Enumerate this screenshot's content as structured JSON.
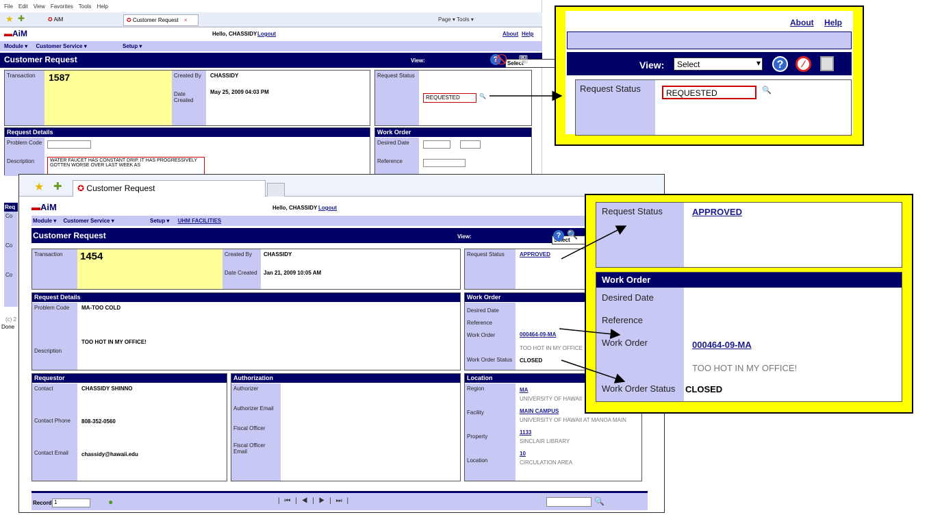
{
  "colors": {
    "navy": "#000066",
    "lavender": "#c8c8f5",
    "yellow": "#ffff00",
    "txn_yellow": "#ffff99",
    "red": "#cc0000"
  },
  "back": {
    "ie_menu": [
      "File",
      "Edit",
      "View",
      "Favorites",
      "Tools",
      "Help"
    ],
    "tabs": [
      "AiM",
      "Customer Request"
    ],
    "ie_tools": "Page ▾   Tools ▾",
    "logo": "AiM",
    "hello": "Hello, CHASSIDY",
    "logout": "Logout",
    "about": "About",
    "help": "Help",
    "menu": [
      "Module ▾",
      "Customer Service ▾",
      "Setup ▾"
    ],
    "title": "Customer Request",
    "view_label": "View:",
    "view_value": "Select",
    "transaction_label": "Transaction",
    "transaction": "1587",
    "created_by_label": "Created By",
    "created_by": "CHASSIDY",
    "date_created_label": "Date Created",
    "date_created": "May 25, 2009 04:03 PM",
    "request_status_label": "Request Status",
    "request_status": "REQUESTED",
    "request_details": "Request Details",
    "problem_code_label": "Problem Code",
    "description_label": "Description",
    "description": "WATER FAUCET HAS CONSTANT DRIP.  IT HAS PROGRESSIVELY GOTTEN WORSE OVER LAST WEEK AS",
    "work_order": "Work Order",
    "desired_date_label": "Desired Date",
    "reference_label": "Reference",
    "edge": [
      "Req",
      "Co",
      "Co",
      "Co",
      "(c) 2",
      "Done"
    ]
  },
  "zoom1": {
    "about": "About",
    "help": "Help",
    "view_label": "View:",
    "view_value": "Select",
    "request_status_label": "Request Status",
    "request_status": "REQUESTED"
  },
  "front": {
    "tab": "Customer Request",
    "logo": "AiM",
    "hello": "Hello, CHASSIDY",
    "logout": "Logout",
    "menu": [
      "Module ▾",
      "Customer Service ▾",
      "Setup ▾",
      "UHM FACILITIES"
    ],
    "title": "Customer Request",
    "view_label": "View:",
    "view_value": "Select",
    "transaction_label": "Transaction",
    "transaction": "1454",
    "created_by_label": "Created By",
    "created_by": "CHASSIDY",
    "date_created_label": "Date Created",
    "date_created": "Jan 21, 2009 10:05 AM",
    "request_status_label": "Request Status",
    "request_status": "APPROVED",
    "request_details": "Request Details",
    "problem_code_label": "Problem Code",
    "problem_code": "MA-TOO COLD",
    "description_label": "Description",
    "description": "TOO HOT IN MY OFFICE!",
    "work_order_hdr": "Work Order",
    "desired_date_label": "Desired Date",
    "reference_label": "Reference",
    "work_order_label": "Work Order",
    "work_order": "000464-09-MA",
    "work_order_desc": "TOO HOT IN MY OFFICE",
    "wo_status_label": "Work Order Status",
    "wo_status": "CLOSED",
    "requestor_hdr": "Requestor",
    "contact_label": "Contact",
    "contact": "CHASSIDY SHINNO",
    "contact_phone_label": "Contact Phone",
    "contact_phone": "808-352-0560",
    "contact_email_label": "Contact Email",
    "contact_email": "chassidy@hawaii.edu",
    "authorization_hdr": "Authorization",
    "authorizer_label": "Authorizer",
    "authorizer_email_label": "Authorizer Email",
    "fiscal_officer_label": "Fiscal Officer",
    "fiscal_officer_email_label": "Fiscal Officer Email",
    "location_hdr": "Location",
    "region_label": "Region",
    "region": "MA",
    "region_desc": "UNIVERSITY OF HAWAII",
    "facility_label": "Facility",
    "facility": "MAIN CAMPUS",
    "facility_desc": "UNIVERSITY OF HAWAII AT MANOA MAIN",
    "property_label": "Property",
    "property": "1133",
    "property_desc": "SINCLAIR LIBRARY",
    "location_label": "Location",
    "location": "10",
    "location_desc": "CIRCULATION AREA",
    "record_label": "Record",
    "record_value": "1",
    "nav": "| ⏮ | ◀ | ▶ | ⏭ |"
  },
  "zoom2": {
    "request_status_label": "Request Status",
    "request_status": "APPROVED",
    "work_order_hdr": "Work Order",
    "desired_date_label": "Desired Date",
    "reference_label": "Reference",
    "work_order_label": "Work Order",
    "work_order": "000464-09-MA",
    "work_order_desc": "TOO HOT IN MY OFFICE!",
    "wo_status_label": "Work Order Status",
    "wo_status": "CLOSED"
  }
}
